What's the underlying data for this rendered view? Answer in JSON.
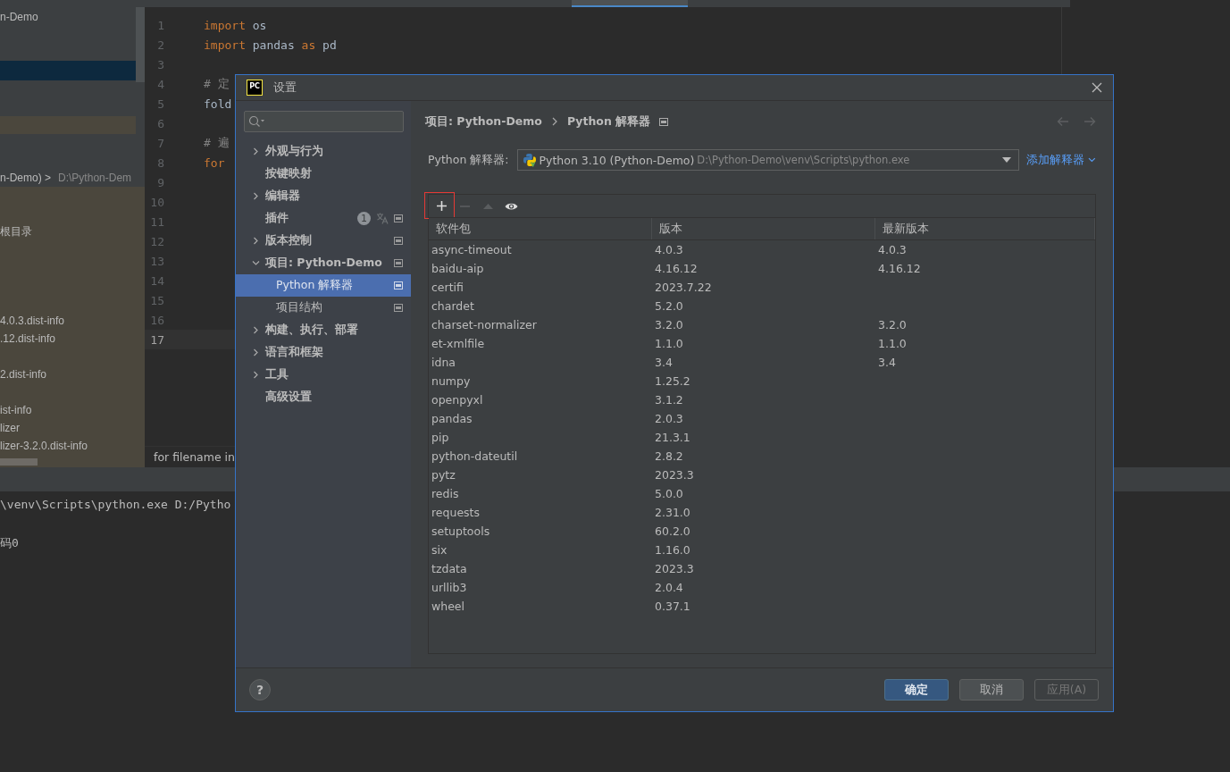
{
  "ide": {
    "project_panel": [
      {
        "text": "n-Demo"
      },
      {
        "text": "n-Demo) >",
        "detail": "D:\\Python-Dem"
      },
      {
        "text": "根目录"
      },
      {
        "text": "4.0.3.dist-info"
      },
      {
        "text": ".12.dist-info"
      },
      {
        "text": "2.dist-info"
      },
      {
        "text": "ist-info"
      },
      {
        "text": "lizer"
      },
      {
        "text": "lizer-3.2.0.dist-info"
      }
    ],
    "code_lines": [
      {
        "number": "1",
        "current": false,
        "tokens": [
          {
            "text": "import",
            "kind": "keyword"
          },
          {
            "text": " os",
            "kind": "name"
          }
        ]
      },
      {
        "number": "2",
        "current": false,
        "tokens": [
          {
            "text": "import",
            "kind": "keyword"
          },
          {
            "text": " pandas ",
            "kind": "name"
          },
          {
            "text": "as",
            "kind": "keyword"
          },
          {
            "text": " pd",
            "kind": "name"
          }
        ]
      },
      {
        "number": "3",
        "current": false
      },
      {
        "number": "4",
        "current": false,
        "tokens": [
          {
            "text": "# 定",
            "kind": "comment"
          }
        ]
      },
      {
        "number": "5",
        "current": false,
        "tokens": [
          {
            "text": "fold",
            "kind": "name"
          }
        ]
      },
      {
        "number": "6",
        "current": false
      },
      {
        "number": "7",
        "current": false,
        "tokens": [
          {
            "text": "# 遍",
            "kind": "comment"
          }
        ]
      },
      {
        "number": "8",
        "current": false,
        "tokens": [
          {
            "text": "for",
            "kind": "keyword"
          }
        ]
      },
      {
        "number": "9",
        "current": false
      },
      {
        "number": "10",
        "current": false
      },
      {
        "number": "11",
        "current": false
      },
      {
        "number": "12",
        "current": false
      },
      {
        "number": "13",
        "current": false
      },
      {
        "number": "14",
        "current": false
      },
      {
        "number": "15",
        "current": false
      },
      {
        "number": "16",
        "current": false
      },
      {
        "number": "17",
        "current": true
      }
    ],
    "breadcrumb": "for filename in",
    "terminal": [
      "\\venv\\Scripts\\python.exe D:/Pytho",
      "码0"
    ]
  },
  "dialog": {
    "logo": "PC",
    "title": "设置",
    "sidebar": [
      {
        "label": "外观与行为",
        "kind": "group",
        "expanded": false,
        "selected": false,
        "project_level": false
      },
      {
        "label": "按键映射",
        "kind": "page",
        "selected": false,
        "project_level": false
      },
      {
        "label": "编辑器",
        "kind": "group",
        "expanded": false,
        "selected": false,
        "project_level": false
      },
      {
        "label": "插件",
        "kind": "page",
        "selected": false,
        "project_level": true,
        "badge": "1"
      },
      {
        "label": "版本控制",
        "kind": "group",
        "expanded": false,
        "selected": false,
        "project_level": true
      },
      {
        "label": "项目: Python-Demo",
        "kind": "group",
        "expanded": true,
        "selected": false,
        "project_level": true,
        "children": [
          {
            "label": "Python 解释器",
            "kind": "page",
            "selected": true,
            "project_level": true
          },
          {
            "label": "项目结构",
            "kind": "page",
            "selected": false,
            "project_level": true
          }
        ]
      },
      {
        "label": "构建、执行、部署",
        "kind": "group",
        "expanded": false,
        "selected": false,
        "project_level": false
      },
      {
        "label": "语言和框架",
        "kind": "group",
        "expanded": false,
        "selected": false,
        "project_level": false
      },
      {
        "label": "工具",
        "kind": "group",
        "expanded": false,
        "selected": false,
        "project_level": false
      },
      {
        "label": "高级设置",
        "kind": "page",
        "selected": false,
        "project_level": false
      }
    ],
    "breadcrumb": [
      "项目: Python-Demo",
      "Python 解释器"
    ],
    "interpreter": {
      "label": "Python 解释器:",
      "name": "Python 3.10 (Python-Demo)",
      "path": "D:\\Python-Demo\\venv\\Scripts\\python.exe"
    },
    "add_interpreter": "添加解释器",
    "tools": [
      {
        "kind": "add",
        "disabled": false,
        "highlighted": true
      },
      {
        "kind": "remove",
        "disabled": true,
        "highlighted": false
      },
      {
        "kind": "upgrade",
        "disabled": true,
        "highlighted": false
      },
      {
        "kind": "show",
        "disabled": false,
        "highlighted": false
      }
    ],
    "table": {
      "columns": [
        "软件包",
        "版本",
        "最新版本"
      ],
      "rows": [
        [
          "async-timeout",
          "4.0.3",
          "4.0.3"
        ],
        [
          "baidu-aip",
          "4.16.12",
          "4.16.12"
        ],
        [
          "certifi",
          "2023.7.22",
          null
        ],
        [
          "chardet",
          "5.2.0",
          null
        ],
        [
          "charset-normalizer",
          "3.2.0",
          "3.2.0"
        ],
        [
          "et-xmlfile",
          "1.1.0",
          "1.1.0"
        ],
        [
          "idna",
          "3.4",
          "3.4"
        ],
        [
          "numpy",
          "1.25.2",
          null
        ],
        [
          "openpyxl",
          "3.1.2",
          null
        ],
        [
          "pandas",
          "2.0.3",
          null
        ],
        [
          "pip",
          "21.3.1",
          null
        ],
        [
          "python-dateutil",
          "2.8.2",
          null
        ],
        [
          "pytz",
          "2023.3",
          null
        ],
        [
          "redis",
          "5.0.0",
          null
        ],
        [
          "requests",
          "2.31.0",
          null
        ],
        [
          "setuptools",
          "60.2.0",
          null
        ],
        [
          "six",
          "1.16.0",
          null
        ],
        [
          "tzdata",
          "2023.3",
          null
        ],
        [
          "urllib3",
          "2.0.4",
          null
        ],
        [
          "wheel",
          "0.37.1",
          null
        ]
      ]
    },
    "help": "?",
    "buttons": [
      {
        "label": "确定",
        "kind": "primary"
      },
      {
        "label": "取消",
        "kind": "normal"
      },
      {
        "label": "应用(A)",
        "kind": "disabled"
      }
    ]
  }
}
